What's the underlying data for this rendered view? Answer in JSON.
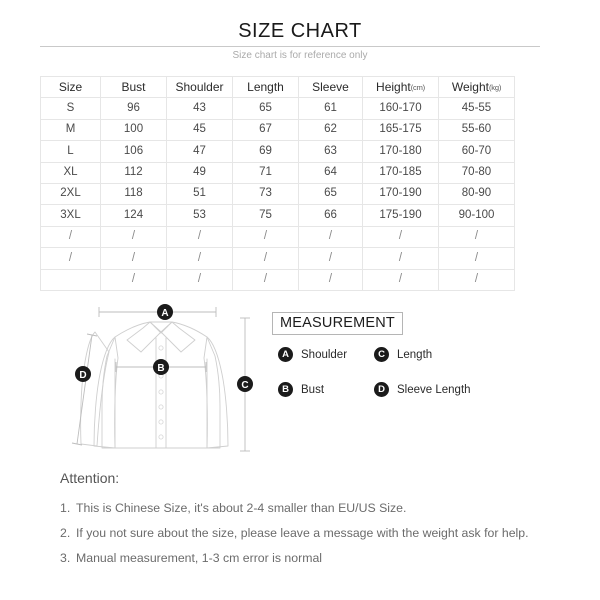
{
  "header": {
    "title": "SIZE CHART",
    "subtitle": "Size chart is for reference only"
  },
  "size_table": {
    "columns": [
      {
        "label": "Size",
        "unit": ""
      },
      {
        "label": "Bust",
        "unit": ""
      },
      {
        "label": "Shoulder",
        "unit": ""
      },
      {
        "label": "Length",
        "unit": ""
      },
      {
        "label": "Sleeve",
        "unit": ""
      },
      {
        "label": "Height",
        "unit": "(cm)"
      },
      {
        "label": "Weight",
        "unit": "(kg)"
      }
    ],
    "rows": [
      [
        "S",
        "96",
        "43",
        "65",
        "61",
        "160-170",
        "45-55"
      ],
      [
        "M",
        "100",
        "45",
        "67",
        "62",
        "165-175",
        "55-60"
      ],
      [
        "L",
        "106",
        "47",
        "69",
        "63",
        "170-180",
        "60-70"
      ],
      [
        "XL",
        "112",
        "49",
        "71",
        "64",
        "170-185",
        "70-80"
      ],
      [
        "2XL",
        "118",
        "51",
        "73",
        "65",
        "170-190",
        "80-90"
      ],
      [
        "3XL",
        "124",
        "53",
        "75",
        "66",
        "175-190",
        "90-100"
      ],
      [
        "/",
        "/",
        "/",
        "/",
        "/",
        "/",
        "/"
      ],
      [
        "/",
        "/",
        "/",
        "/",
        "/",
        "/",
        "/"
      ],
      [
        "",
        "/",
        "/",
        "/",
        "/",
        "/",
        "/"
      ]
    ]
  },
  "diagram": {
    "markers": [
      {
        "id": "A",
        "measure": "shoulder"
      },
      {
        "id": "B",
        "measure": "bust"
      },
      {
        "id": "C",
        "measure": "length"
      },
      {
        "id": "D",
        "measure": "sleeve-length"
      }
    ]
  },
  "measurement": {
    "heading": "MEASUREMENT",
    "items": [
      {
        "badge": "A",
        "label": "Shoulder"
      },
      {
        "badge": "C",
        "label": "Length"
      },
      {
        "badge": "B",
        "label": "Bust"
      },
      {
        "badge": "D",
        "label": "Sleeve Length"
      }
    ]
  },
  "attention": {
    "heading": "Attention:",
    "notes": [
      {
        "num": "1.",
        "text": "This is Chinese Size, it's about 2-4 smaller than EU/US Size."
      },
      {
        "num": "2.",
        "text": "If you not sure about the size, please leave a message with the weight ask for help."
      },
      {
        "num": "3.",
        "text": "Manual measurement, 1-3 cm error is normal"
      }
    ]
  },
  "colors": {
    "text_dark": "#1a1a1a",
    "text_body": "#6b6b6b",
    "border": "#e6e6e6",
    "badge": "#1b1b1b",
    "rule": "#c9c9c9"
  }
}
